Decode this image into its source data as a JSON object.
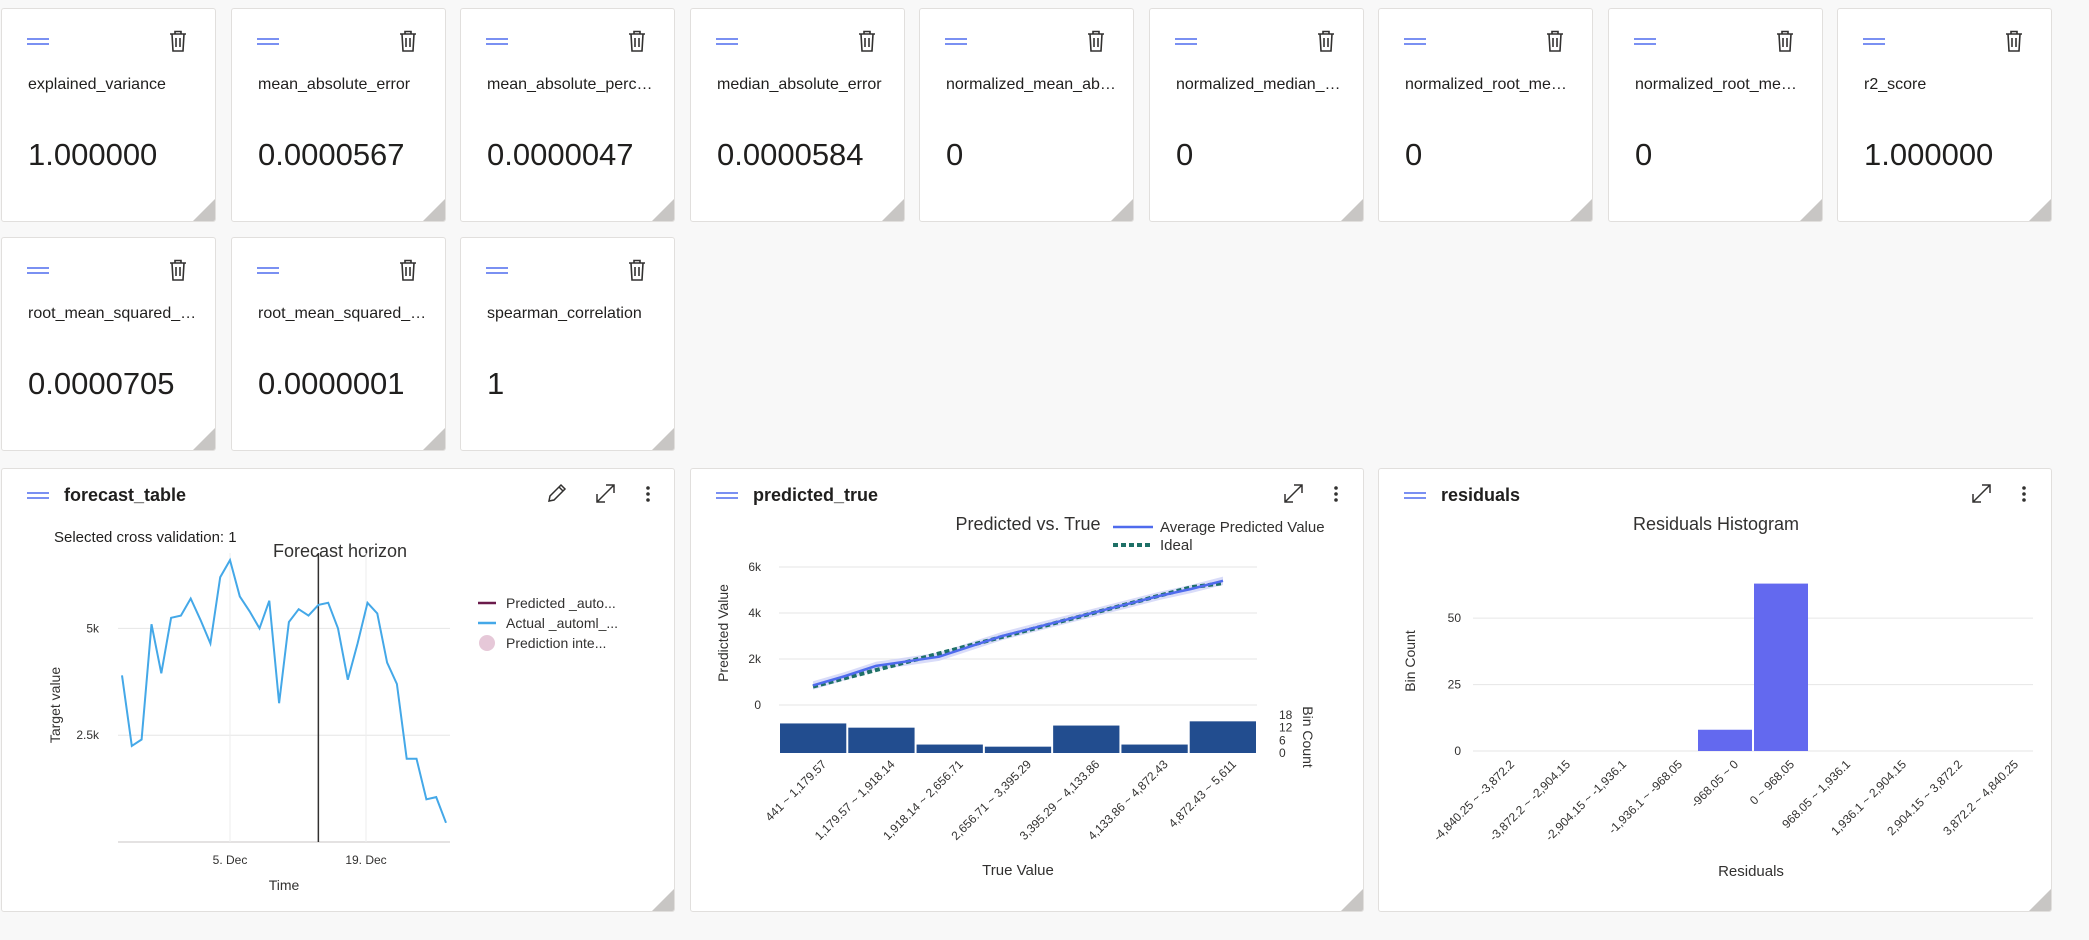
{
  "metrics_row1": [
    {
      "label": "explained_variance",
      "value": "1.000000"
    },
    {
      "label": "mean_absolute_error",
      "value": "0.0000567"
    },
    {
      "label": "mean_absolute_perce...",
      "value": "0.0000047"
    },
    {
      "label": "median_absolute_error",
      "value": "0.0000584"
    },
    {
      "label": "normalized_mean_abs...",
      "value": "0"
    },
    {
      "label": "normalized_median_a...",
      "value": "0"
    },
    {
      "label": "normalized_root_mean...",
      "value": "0"
    },
    {
      "label": "normalized_root_mean...",
      "value": "0"
    },
    {
      "label": "r2_score",
      "value": "1.000000"
    }
  ],
  "metrics_row2": [
    {
      "label": "root_mean_squared_er...",
      "value": "0.0000705"
    },
    {
      "label": "root_mean_squared_lo...",
      "value": "0.0000001"
    },
    {
      "label": "spearman_correlation",
      "value": "1"
    }
  ],
  "forecast_card": {
    "title": "forecast_table",
    "selected_cv": "Selected cross validation: 1"
  },
  "predicted_card": {
    "title": "predicted_true"
  },
  "residuals_card": {
    "title": "residuals"
  },
  "colors": {
    "accent": "#4f6bed",
    "actual_line": "#44a8e8",
    "predicted_line": "#6b1b4b",
    "interval": "#e6c8d8",
    "bar_dark": "#224d8f",
    "ideal": "#1e7066",
    "residual_bar": "#6369ef"
  },
  "chart_data": [
    {
      "type": "line",
      "title": "Forecast horizon",
      "xlabel": "Time",
      "ylabel": "Target value",
      "x_ticks": [
        "5. Dec",
        "19. Dec"
      ],
      "y_ticks": [
        "2.5k",
        "5k"
      ],
      "ylim": [
        0,
        7000
      ],
      "legend": [
        "Predicted _auto...",
        "Actual _automl_...",
        "Prediction inte..."
      ],
      "legend_position": "right",
      "series": [
        {
          "name": "Actual _automl_...",
          "values": [
            3900,
            2250,
            2400,
            5100,
            3950,
            5250,
            5300,
            5700,
            5200,
            4650,
            6200,
            6600,
            5750,
            5400,
            5000,
            5650,
            3250,
            5150,
            5450,
            5300,
            5550,
            5600,
            5000,
            3800,
            4650,
            5600,
            5350,
            4200,
            3700,
            1950,
            1950,
            1000,
            1050,
            450
          ]
        }
      ],
      "forecast_start_index": 20
    },
    {
      "type": "line",
      "title": "Predicted vs. True",
      "xlabel": "True Value",
      "ylabel": "Predicted Value",
      "y_ticks": [
        "0",
        "2k",
        "4k",
        "6k"
      ],
      "ylim": [
        0,
        6000
      ],
      "legend": [
        "Average Predicted Value",
        "Ideal"
      ],
      "legend_position": "top-right",
      "categories": [
        "441 ~ 1,179.57",
        "1,179.57 ~ 1,918.14",
        "1,918.14 ~ 2,656.71",
        "2,656.71 ~ 3,395.29",
        "3,395.29 ~ 4,133.86",
        "4,133.86 ~ 4,872.43",
        "4,872.43 ~ 5,611"
      ],
      "average_predicted": [
        850,
        1250,
        1700,
        1900,
        2100,
        2550,
        3000,
        3350,
        3700,
        4050,
        4400,
        4750,
        5050,
        5400
      ],
      "ideal": [
        800,
        1160,
        1520,
        1880,
        2240,
        2600,
        2960,
        3320,
        3680,
        4040,
        4400,
        4760,
        5120,
        5300
      ],
      "bin_axis_label": "Bin Count",
      "bin_ticks": [
        "0",
        "6",
        "12",
        "18"
      ],
      "bin_counts": [
        14,
        12,
        4,
        3,
        13,
        4,
        15
      ]
    },
    {
      "type": "bar",
      "title": "Residuals Histogram",
      "xlabel": "Residuals",
      "ylabel": "Bin Count",
      "y_ticks": [
        "0",
        "25",
        "50"
      ],
      "ylim": [
        0,
        70
      ],
      "categories": [
        "-4,840.25 ~ -3,872.2",
        "-3,872.2 ~ -2,904.15",
        "-2,904.15 ~ -1,936.1",
        "-1,936.1 ~ -968.05",
        "-968.05 ~ 0",
        "0 ~ 968.05",
        "968.05 ~ 1,936.1",
        "1,936.1 ~ 2,904.15",
        "2,904.15 ~ 3,872.2",
        "3,872.2 ~ 4,840.25"
      ],
      "values": [
        0,
        0,
        0,
        0,
        8,
        63,
        0,
        0,
        0,
        0
      ]
    }
  ]
}
